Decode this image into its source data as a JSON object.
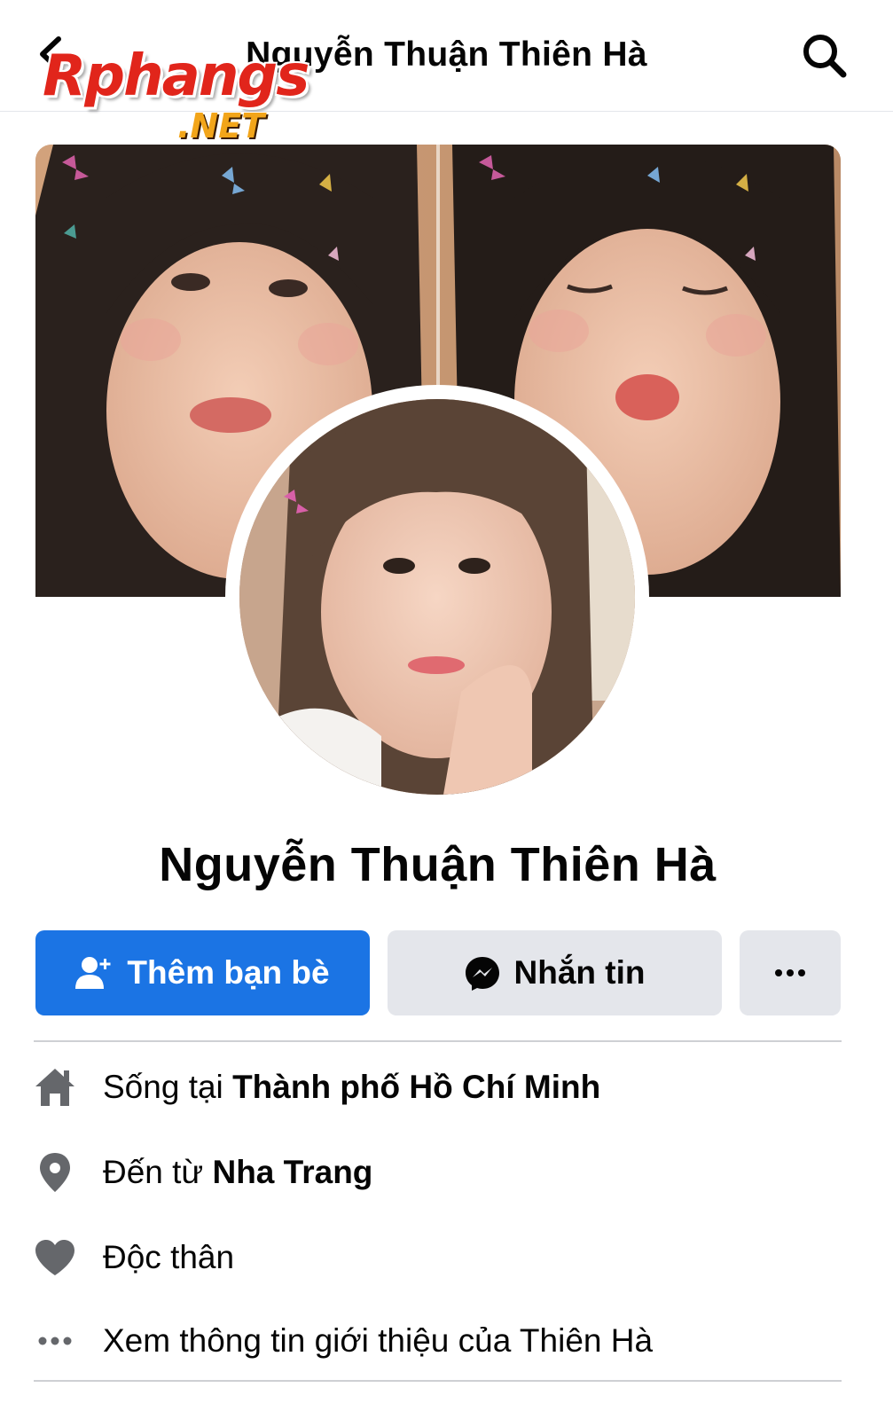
{
  "header": {
    "title": "Nguyễn Thuận Thiên Hà",
    "back_icon": "chevron-left-icon",
    "search_icon": "search-icon"
  },
  "watermark": {
    "brand": "Rphangs",
    "domain": ".NET"
  },
  "profile": {
    "name": "Nguyễn Thuận Thiên Hà"
  },
  "actions": {
    "add_friend_label": "Thêm bạn bè",
    "message_label": "Nhắn tin",
    "more_icon": "more-dots-icon"
  },
  "intro": [
    {
      "icon": "home-icon",
      "prefix": "Sống tại ",
      "value": "Thành phố Hồ Chí Minh"
    },
    {
      "icon": "location-pin-icon",
      "prefix": "Đến từ ",
      "value": "Nha Trang"
    },
    {
      "icon": "heart-icon",
      "prefix": "Độc thân",
      "value": ""
    },
    {
      "icon": "more-dots-icon",
      "prefix": "Xem thông tin giới thiệu của Thiên Hà",
      "value": ""
    }
  ],
  "colors": {
    "primary_blue": "#1b74e4",
    "secondary_gray": "#e4e6eb",
    "icon_gray": "#65676b",
    "text": "#050505"
  }
}
